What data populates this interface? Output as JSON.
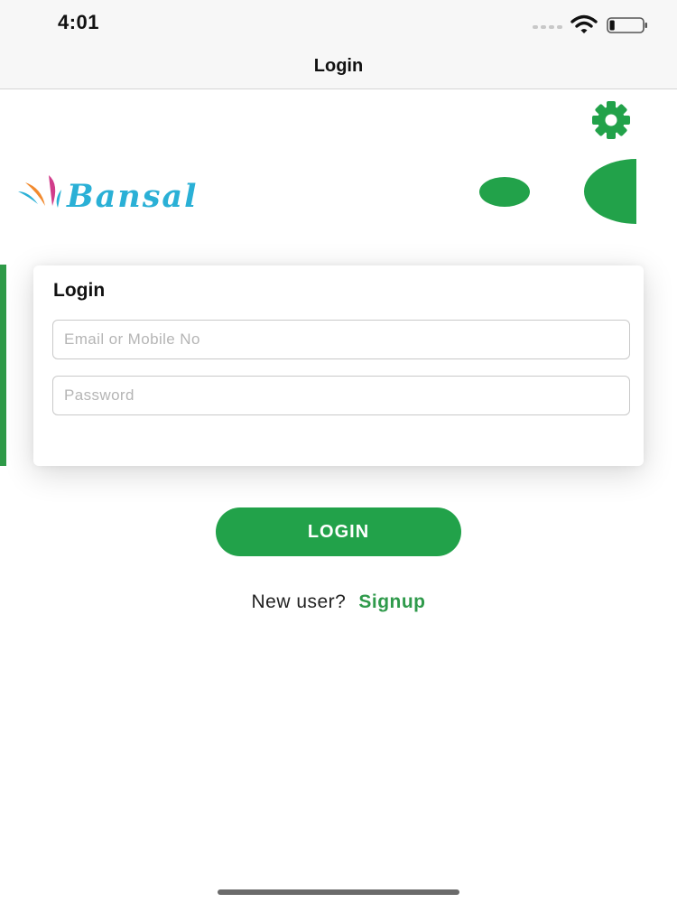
{
  "status_bar": {
    "time": "4:01",
    "icons": [
      "signal-dots-icon",
      "wifi-icon",
      "battery-icon"
    ],
    "battery_level": 0.15
  },
  "nav": {
    "title": "Login"
  },
  "header": {
    "settings_icon": "gear-icon",
    "brand_name": "Bansal"
  },
  "login_card": {
    "title": "Login",
    "email": {
      "value": "",
      "placeholder": "Email or Mobile No"
    },
    "password": {
      "value": "",
      "placeholder": "Password"
    }
  },
  "actions": {
    "login_label": "LOGIN",
    "signup_prompt": "New user?",
    "signup_label": "Signup"
  },
  "colors": {
    "accent": "#22a24a",
    "link": "#2f9a4b",
    "bar_background": "#f7f7f7",
    "brand_blue": "#2ab0d6",
    "logo_pink": "#d13c8a",
    "logo_orange": "#f28a2e"
  }
}
